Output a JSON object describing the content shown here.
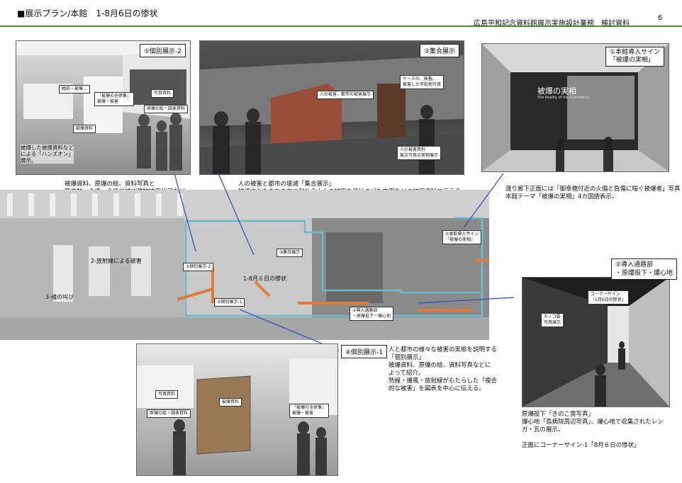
{
  "header": {
    "title": "■展示プラン/本館　1-8月6日の惨状",
    "subtitle": "広島平和記念資料館展示実施設計業務　検討資料",
    "page": "6"
  },
  "photos": {
    "p5": {
      "tag": "⑤個別展示-2",
      "labels": {
        "a": "戦前・被爆...",
        "b": "「被爆の全体像」\n被爆・被害",
        "c": "写真資料",
        "d": "原爆の絵・図表資料",
        "e": "被爆資料"
      },
      "note": "被爆した被爆資料など\nによる「ハンズオン」\n展示。"
    },
    "p3": {
      "tag": "③集合展示",
      "labels": {
        "a": "人の被害、都市の被害展示",
        "b": "ケースの、被害。\n被害した市街地写真",
        "c": "人の被害資料\n被災写真の実物展示"
      }
    },
    "p1": {
      "tag": "①本館導入サイン\n「被爆の実相」",
      "sign": "被爆の実相",
      "sign_en": "The Reality of the A-bombing"
    },
    "p2": {
      "tag": "②導入通路部\n・原爆投下・爆心地",
      "labels": {
        "a": "コーナーサイン\n「1月6日の惨状」",
        "b": "キノコ雲\n写真展示"
      }
    },
    "p4": {
      "tag": "④個別展示-1",
      "labels": {
        "a": "写真資料",
        "b": "原爆の絵・図表資料",
        "c": "被爆資料",
        "d": "「被爆の全体像」\n被爆・被害"
      }
    }
  },
  "captions": {
    "c5": "被爆資料、原爆の絵、資料写真と\n死者数、全壊・全焼地域や建物被害状況など\n「被害の全体像」を地図・図表等で伝える。",
    "c3": "人の被害と都市の壊滅「集合展示」\n被壊されたまちの中に倒れる人々の被害を焼けこげた衣服などの被害資料で伝える。\n背景は都市の壊滅写真資料、手前には人の被害の写真資料を展示。",
    "c1": "渡り廊下正面には「御幸橋付近の火傷と負傷に喘ぐ被爆者」写真\n本館テーマ「被爆の実相」4カ国語表示。",
    "c4": "人と都市の様々な被害の実態を説明する\n「個別展示」\n被爆資料、原爆の絵、資料写真などに\nよって紹介。\n熱線・爆風・放射線がもたらした「複合\n的な被害」を図表を中心に伝える。",
    "c2": "原爆投下「きのこ雲写真」\n爆心地「島病院周辺写真」、爆心地で収集されたレン\nガ・瓦の展示。\n\n正面にコーナーサイン-1「8月６日の惨状」"
  },
  "plan": {
    "labels": {
      "l1": "①本館導入サイン\n「被爆の実相」",
      "l2": "②導入通路部\n・原爆投下・爆心地",
      "l3": "③集合展示",
      "l5": "⑤個別展示-2",
      "l4": "④個別展示-1",
      "l6": "1-8月６日の惨状",
      "l7": "3-魂の叫び",
      "l8": "2-放射線による被害"
    }
  },
  "colors": {
    "accent": "#4a8a4a",
    "route": "#6fb9c9",
    "arrow": "#e07a3a",
    "pointer": "#2b4fb5"
  }
}
